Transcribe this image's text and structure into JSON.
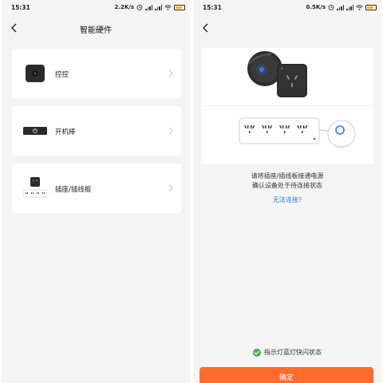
{
  "left_screen": {
    "status": {
      "time": "15:31",
      "speed": "2.2K/s"
    },
    "nav": {
      "title": "智能硬件"
    },
    "devices": [
      {
        "label": "控控"
      },
      {
        "label": "开机棒"
      },
      {
        "label": "插座/插线板"
      }
    ]
  },
  "right_screen": {
    "status": {
      "time": "15:31",
      "speed": "0.5K/s"
    },
    "instruction_line1": "请将插座/插线板接通电源",
    "instruction_line2": "确认设备处于待连接状态",
    "help_link": "无法连接?",
    "indicator_text": "指示灯蓝灯快闪状态",
    "confirm_label": "确定"
  },
  "colors": {
    "accent": "#ff6b2c",
    "link": "#1e88e5",
    "check": "#4caf50",
    "led": "#2979ff",
    "background": "#f4f4f4"
  },
  "icons": [
    "back-arrow-icon",
    "chevron-right-icon",
    "alarm-clock-icon",
    "signal-icon",
    "wifi-icon",
    "battery-icon",
    "check-circle-icon"
  ]
}
